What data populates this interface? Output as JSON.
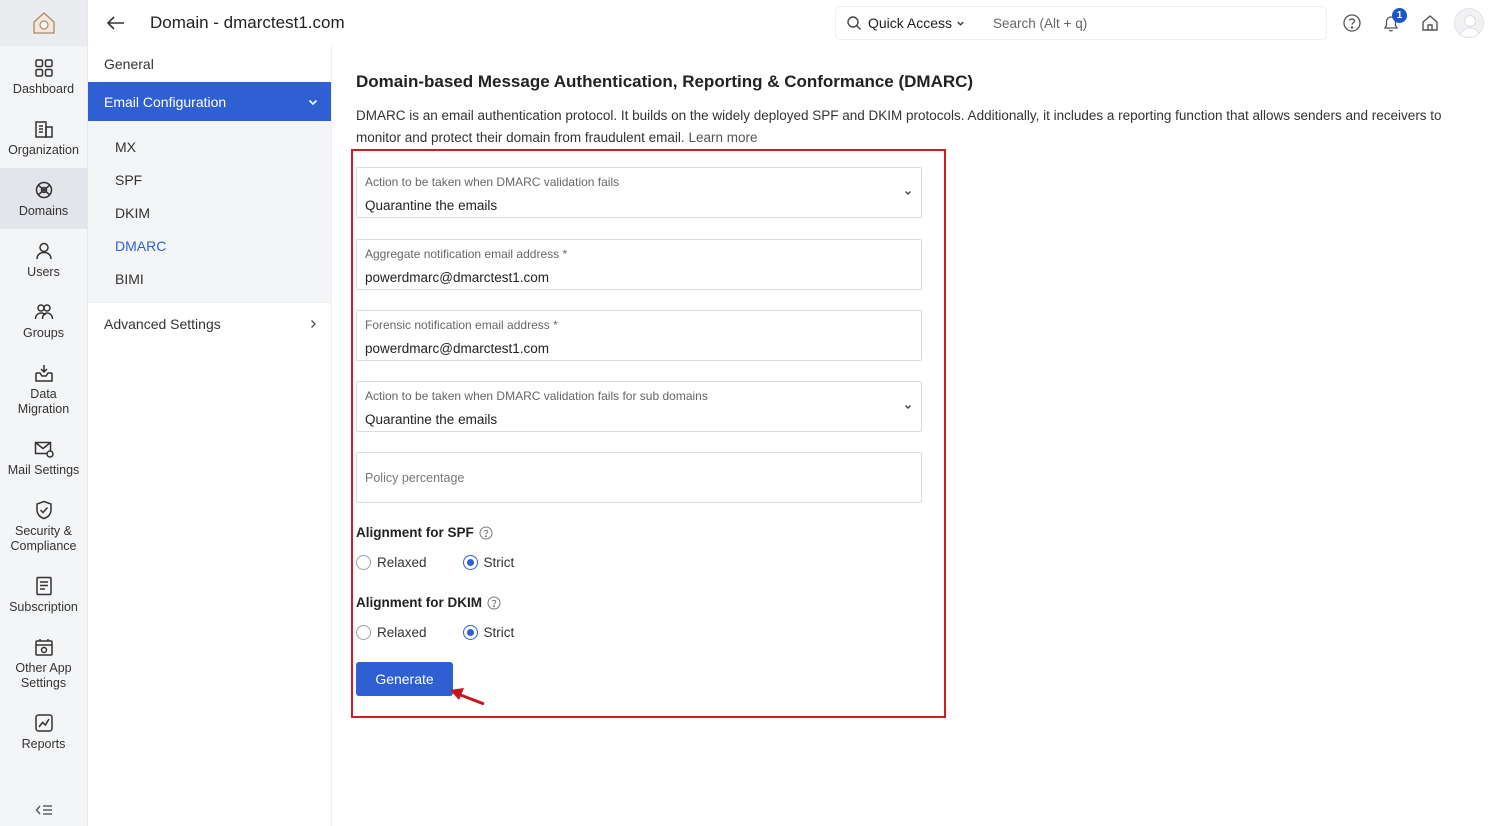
{
  "topbar": {
    "title": "Domain - dmarctest1.com",
    "quick_access": "Quick Access",
    "search_placeholder": "Search (Alt + q)",
    "notification_count": "1"
  },
  "rail": {
    "items": [
      {
        "label": "Dashboard",
        "icon": "dashboard-icon"
      },
      {
        "label": "Organization",
        "icon": "organization-icon"
      },
      {
        "label": "Domains",
        "icon": "domains-icon"
      },
      {
        "label": "Users",
        "icon": "users-icon"
      },
      {
        "label": "Groups",
        "icon": "groups-icon"
      },
      {
        "label": "Data Migration",
        "icon": "data-migration-icon"
      },
      {
        "label": "Mail Settings",
        "icon": "mail-settings-icon"
      },
      {
        "label": "Security & Compliance",
        "icon": "security-icon"
      },
      {
        "label": "Subscription",
        "icon": "subscription-icon"
      },
      {
        "label": "Other App Settings",
        "icon": "other-app-settings-icon"
      },
      {
        "label": "Reports",
        "icon": "reports-icon"
      }
    ]
  },
  "subnav": {
    "general": "General",
    "section": "Email Configuration",
    "children": [
      "MX",
      "SPF",
      "DKIM",
      "DMARC",
      "BIMI"
    ],
    "advanced": "Advanced Settings"
  },
  "main": {
    "title": "Domain-based Message Authentication, Reporting & Conformance (DMARC)",
    "description": "DMARC is an email authentication protocol. It builds on the widely deployed SPF and DKIM protocols. Additionally, it includes a reporting function that allows senders and receivers to monitor and protect their domain from fraudulent email.",
    "learn_more": "Learn more",
    "fields": {
      "action_label": "Action to be taken when DMARC validation fails",
      "action_value": "Quarantine the emails",
      "aggregate_label": "Aggregate notification email address *",
      "aggregate_value": "powerdmarc@dmarctest1.com",
      "forensic_label": "Forensic notification email address *",
      "forensic_value": "powerdmarc@dmarctest1.com",
      "sub_action_label": "Action to be taken when DMARC validation fails for sub domains",
      "sub_action_value": "Quarantine the emails",
      "policy_placeholder": "Policy percentage"
    },
    "spf_alignment": {
      "label": "Alignment for SPF",
      "options": [
        "Relaxed",
        "Strict"
      ],
      "selected": "Strict"
    },
    "dkim_alignment": {
      "label": "Alignment for DKIM",
      "options": [
        "Relaxed",
        "Strict"
      ],
      "selected": "Strict"
    },
    "generate_label": "Generate",
    "accent_color": "#2e5fd3",
    "highlight_color": "#d11a22"
  }
}
